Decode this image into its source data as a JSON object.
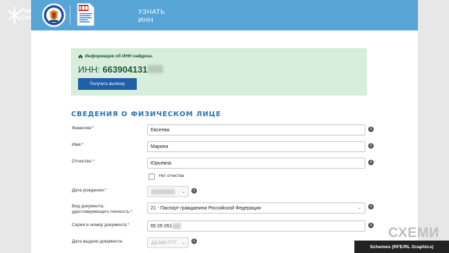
{
  "radio_logo": {
    "line1": "Радіо",
    "line2": "Свобода"
  },
  "header": {
    "title_line1": "УЗНАТЬ",
    "title_line2": "ИНН"
  },
  "notice": {
    "message": "Информация об ИНН найдена.",
    "inn_label": "ИНН:",
    "inn_value": "663904131",
    "button": "Получить выписку"
  },
  "section_title": "СВЕДЕНИЯ О ФИЗИЧЕСКОМ ЛИЦЕ",
  "form": {
    "surname_label": "Фамилия:",
    "surname_value": "Евсеева",
    "name_label": "Имя:",
    "name_value": "Марина",
    "patronymic_label": "Отчество:",
    "patronymic_value": "Юрьевна",
    "no_patronymic": "Нет отчества",
    "birth_label": "Дата рождения:",
    "doctype_label1": "Вид документа,",
    "doctype_label2": "удостоверяющего личность:",
    "doctype_value": "21 - Паспорт гражданина Российской Федерации",
    "series_label": "Серия и номер документа:",
    "series_value": "65 05 051",
    "issue_label": "Дата выдачи документа:",
    "issue_placeholder": "ДД.ММ.ГГГГ",
    "required_mark": "*"
  },
  "watermark": "СХЕМИ",
  "credit": "Schemes (RFE/RL Graphics)",
  "colors": {
    "header": "#56a5d6",
    "notice_bg": "#d7eedd",
    "button": "#1f5ea8",
    "section_title": "#2a72b3"
  }
}
